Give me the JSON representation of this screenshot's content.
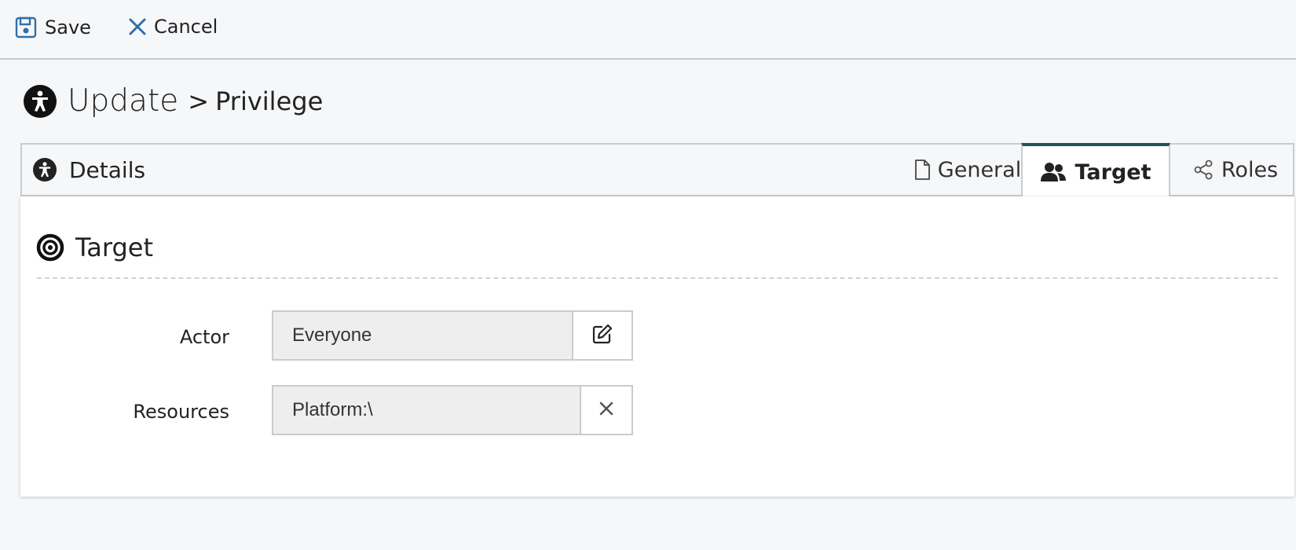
{
  "toolbar": {
    "save_label": "Save",
    "cancel_label": "Cancel"
  },
  "header": {
    "title": "Update",
    "separator": ">",
    "subtitle": "Privilege"
  },
  "tabs": {
    "details_label": "Details",
    "items": [
      {
        "label": "General",
        "icon": "file-icon"
      },
      {
        "label": "Target",
        "icon": "users-icon",
        "active": true
      },
      {
        "label": "Roles",
        "icon": "share-nodes-icon"
      }
    ]
  },
  "section": {
    "title": "Target"
  },
  "form": {
    "actor_label": "Actor",
    "actor_value": "Everyone",
    "resources_label": "Resources",
    "resources_value": "Platform:\\"
  },
  "colors": {
    "accent": "#1e5455",
    "icon_blue": "#2f6fa7",
    "background": "#f6f7f9"
  }
}
